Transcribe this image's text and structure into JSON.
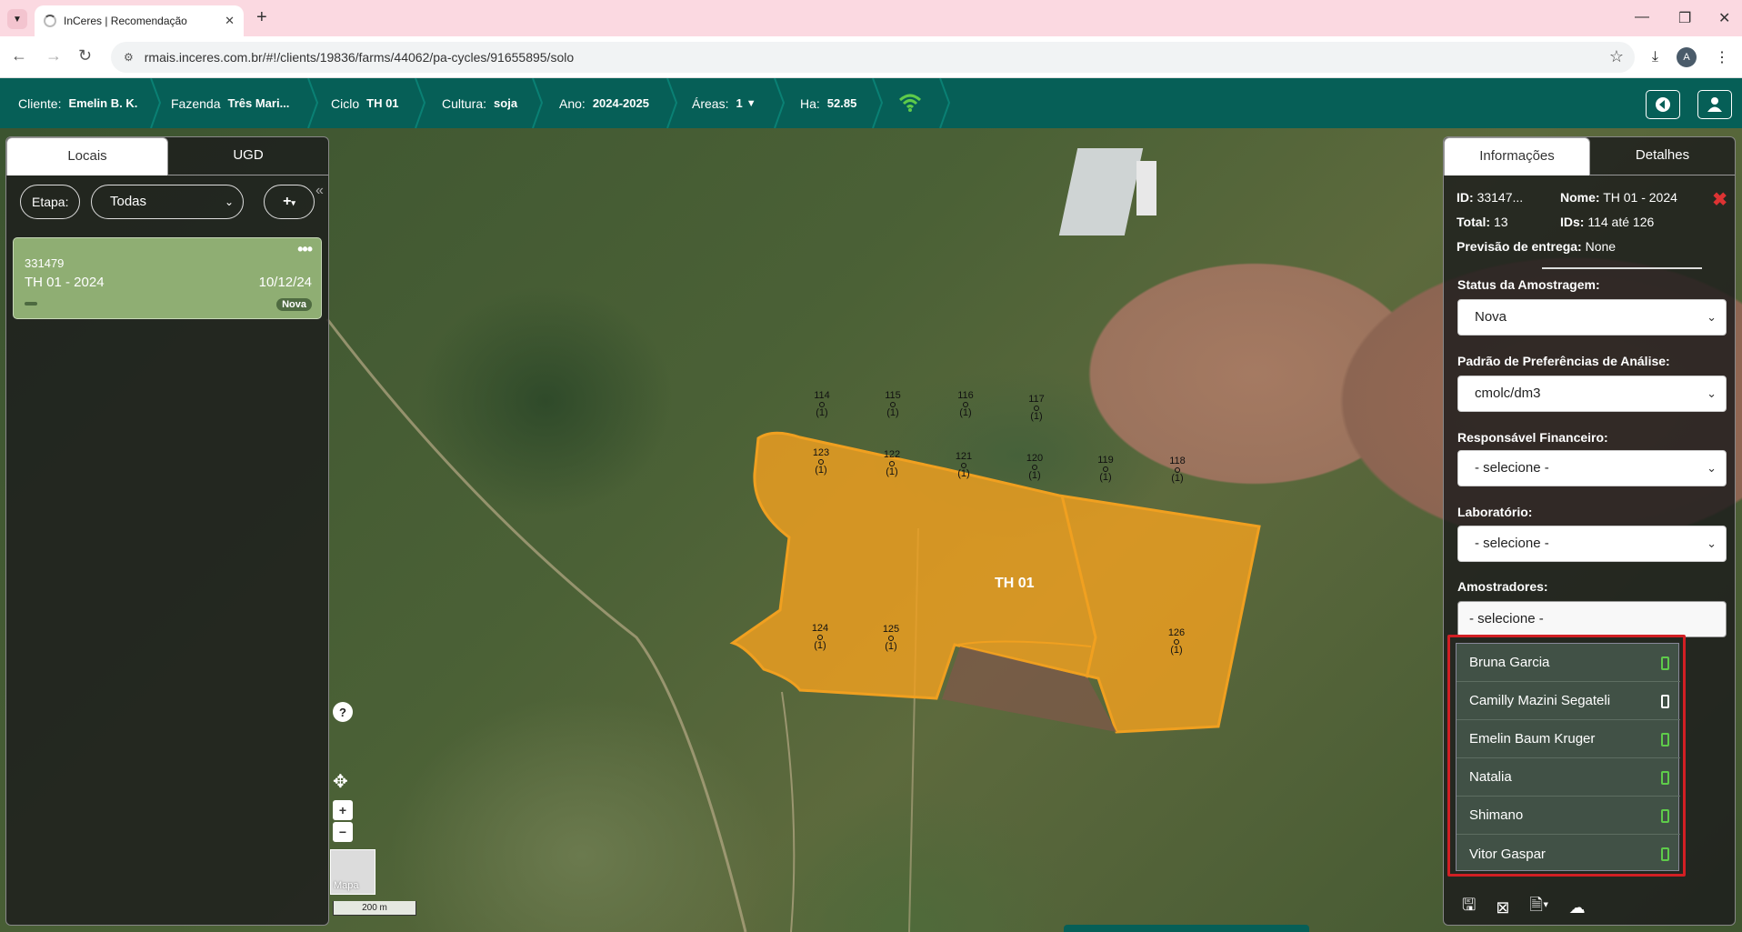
{
  "browser": {
    "tab_title": "InCeres | Recomendação",
    "url": "rmais.inceres.com.br/#!/clients/19836/farms/44062/pa-cycles/91655895/solo",
    "profile_initial": "A"
  },
  "header": {
    "cliente_label": "Cliente:",
    "cliente_value": "Emelin B. K.",
    "fazenda_label": "Fazenda",
    "fazenda_value": "Três Mari...",
    "ciclo_label": "Ciclo",
    "ciclo_value": "TH 01",
    "cultura_label": "Cultura:",
    "cultura_value": "soja",
    "ano_label": "Ano:",
    "ano_value": "2024-2025",
    "areas_label": "Áreas:",
    "areas_value": "1",
    "ha_label": "Ha:",
    "ha_value": "52.85"
  },
  "left_panel": {
    "tabs": [
      "Locais",
      "UGD"
    ],
    "etapa_label": "Etapa:",
    "etapa_value": "Todas",
    "add_label": "+",
    "card": {
      "id": "331479",
      "name": "TH 01 - 2024",
      "date": "10/12/24",
      "status": "Nova",
      "menu": "•••"
    }
  },
  "map": {
    "field_label": "TH 01",
    "points": [
      {
        "id": "114",
        "count": "(1)"
      },
      {
        "id": "115",
        "count": "(1)"
      },
      {
        "id": "116",
        "count": "(1)"
      },
      {
        "id": "117",
        "count": "(1)"
      },
      {
        "id": "123",
        "count": "(1)"
      },
      {
        "id": "122",
        "count": "(1)"
      },
      {
        "id": "121",
        "count": "(1)"
      },
      {
        "id": "120",
        "count": "(1)"
      },
      {
        "id": "119",
        "count": "(1)"
      },
      {
        "id": "118",
        "count": "(1)"
      },
      {
        "id": "124",
        "count": "(1)"
      },
      {
        "id": "125",
        "count": "(1)"
      },
      {
        "id": "126",
        "count": "(1)"
      }
    ],
    "help": "?",
    "zoom_in": "+",
    "zoom_out": "−",
    "thumb_label": "Mapa",
    "scale_label": "200 m",
    "field_color": "#f0a020"
  },
  "right_panel": {
    "tabs": [
      "Informações",
      "Detalhes"
    ],
    "id_label": "ID:",
    "id_value": "33147...",
    "nome_label": "Nome:",
    "nome_value": "TH 01 - 2024",
    "total_label": "Total:",
    "total_value": "13",
    "ids_label": "IDs:",
    "ids_value": "114 até 126",
    "previsao_label": "Previsão de entrega:",
    "previsao_value": "None",
    "status_label": "Status da Amostragem:",
    "status_value": "Nova",
    "padrao_label": "Padrão de Preferências de Análise:",
    "padrao_value": "cmolc/dm3",
    "responsavel_label": "Responsável Financeiro:",
    "responsavel_value": "- selecione -",
    "laboratorio_label": "Laboratório:",
    "laboratorio_value": "- selecione -",
    "amostradores_label": "Amostradores:",
    "amostradores_value": "- selecione -",
    "amostradores_options": [
      {
        "name": "Bruna Garcia",
        "device": "green"
      },
      {
        "name": "Camilly Mazini Segateli",
        "device": "white"
      },
      {
        "name": "Emelin Baum Kruger",
        "device": "green"
      },
      {
        "name": "Natalia",
        "device": "green"
      },
      {
        "name": "Shimano",
        "device": "green"
      },
      {
        "name": "Vitor Gaspar",
        "device": "green"
      }
    ]
  },
  "colors": {
    "brand": "#065f57",
    "highlight": "#d21f24",
    "device_active": "#5ecb4a"
  }
}
